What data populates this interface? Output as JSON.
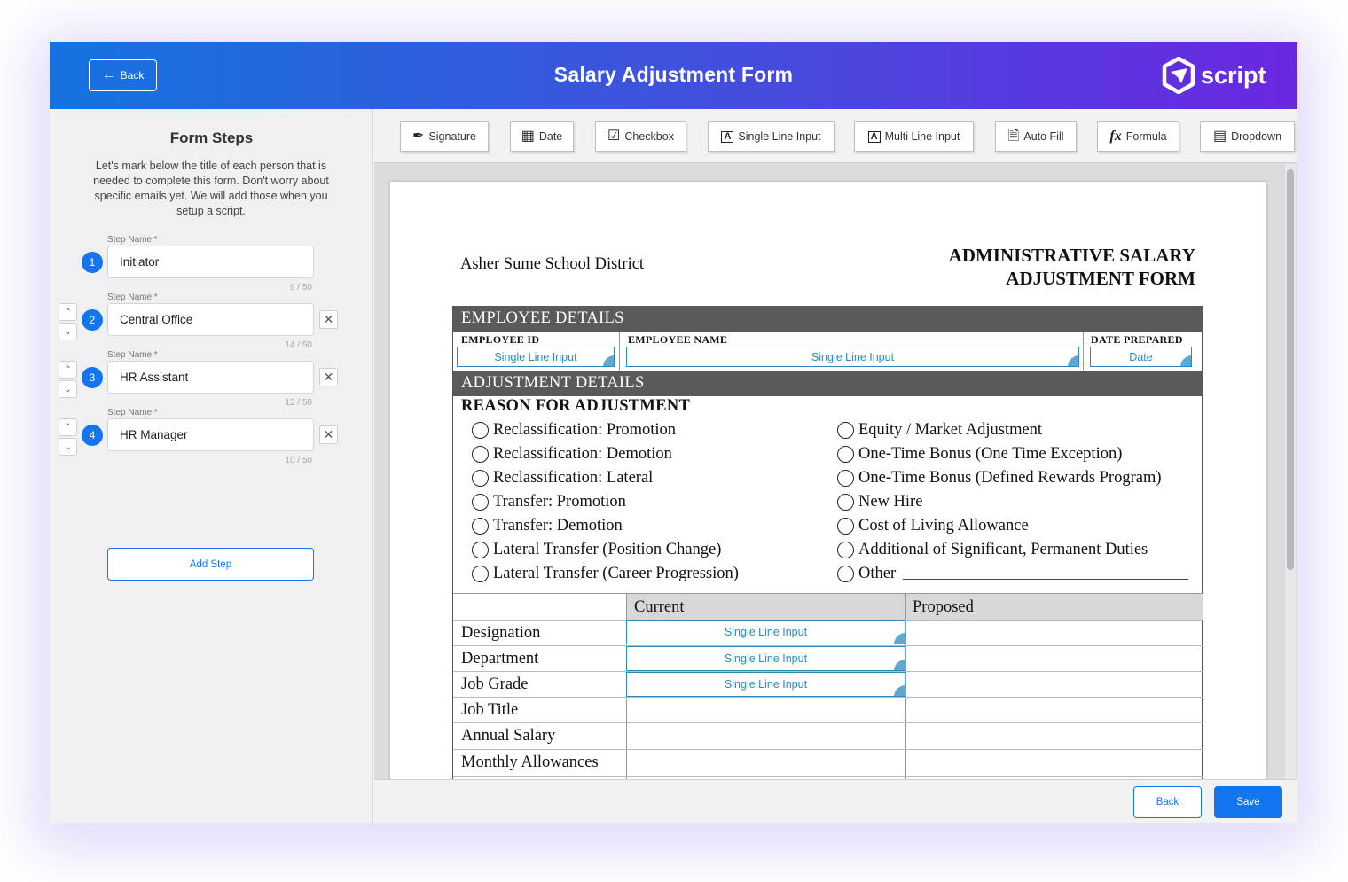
{
  "header": {
    "back_label": "Back",
    "title": "Salary Adjustment Form",
    "logo_text": "script"
  },
  "sidebar": {
    "title": "Form Steps",
    "description": "Let's mark below the title of each person that is needed to complete this form. Don't worry about specific emails yet. We will add those when you setup a script.",
    "step_label": "Step Name *",
    "steps": [
      {
        "number": "1",
        "name": "Initiator",
        "count": "9 / 50"
      },
      {
        "number": "2",
        "name": "Central Office",
        "count": "14 / 50"
      },
      {
        "number": "3",
        "name": "HR Assistant",
        "count": "12 / 50"
      },
      {
        "number": "4",
        "name": "HR Manager",
        "count": "10 / 50"
      }
    ],
    "add_step_label": "Add Step"
  },
  "toolbar": {
    "tools": [
      {
        "label": "Signature",
        "icon": "signature-icon"
      },
      {
        "label": "Date",
        "icon": "calendar-icon"
      },
      {
        "label": "Checkbox",
        "icon": "checkbox-icon"
      },
      {
        "label": "Single Line Input",
        "icon": "text-field-icon"
      },
      {
        "label": "Multi Line Input",
        "icon": "text-area-icon"
      },
      {
        "label": "Auto Fill",
        "icon": "document-icon"
      },
      {
        "label": "Formula",
        "icon": "formula-icon"
      },
      {
        "label": "Dropdown",
        "icon": "dropdown-icon"
      }
    ]
  },
  "document": {
    "organization": "Asher Sume School District",
    "title_line1": "ADMINISTRATIVE SALARY",
    "title_line2": "ADJUSTMENT FORM",
    "employee_section": "EMPLOYEE DETAILS",
    "employee_id_label": "EMPLOYEE ID",
    "employee_name_label": "EMPLOYEE NAME",
    "date_prepared_label": "DATE PREPARED",
    "field_single_line": "Single Line Input",
    "field_date": "Date",
    "adjustment_section": "ADJUSTMENT DETAILS",
    "reason_title": "REASON FOR ADJUSTMENT",
    "reasons_left": [
      "Reclassification: Promotion",
      "Reclassification: Demotion",
      "Reclassification: Lateral",
      "Transfer: Promotion",
      "Transfer: Demotion",
      "Lateral Transfer (Position Change)",
      "Lateral Transfer (Career Progression)"
    ],
    "reasons_right": [
      "Equity / Market Adjustment",
      "One-Time Bonus (One Time Exception)",
      "One-Time Bonus (Defined Rewards Program)",
      "New Hire",
      "Cost of Living Allowance",
      "Additional of Significant, Permanent Duties",
      "Other"
    ],
    "col_current": "Current",
    "col_proposed": "Proposed",
    "rows": [
      "Designation",
      "Department",
      "Job Grade",
      "Job Title",
      "Annual Salary",
      "Monthly Allowances"
    ]
  },
  "footer": {
    "back_label": "Back",
    "save_label": "Save"
  },
  "colors": {
    "accent": "#1476ef",
    "header_start": "#1473e0",
    "header_end": "#6a27e0",
    "field_border": "#2e8bb8"
  }
}
